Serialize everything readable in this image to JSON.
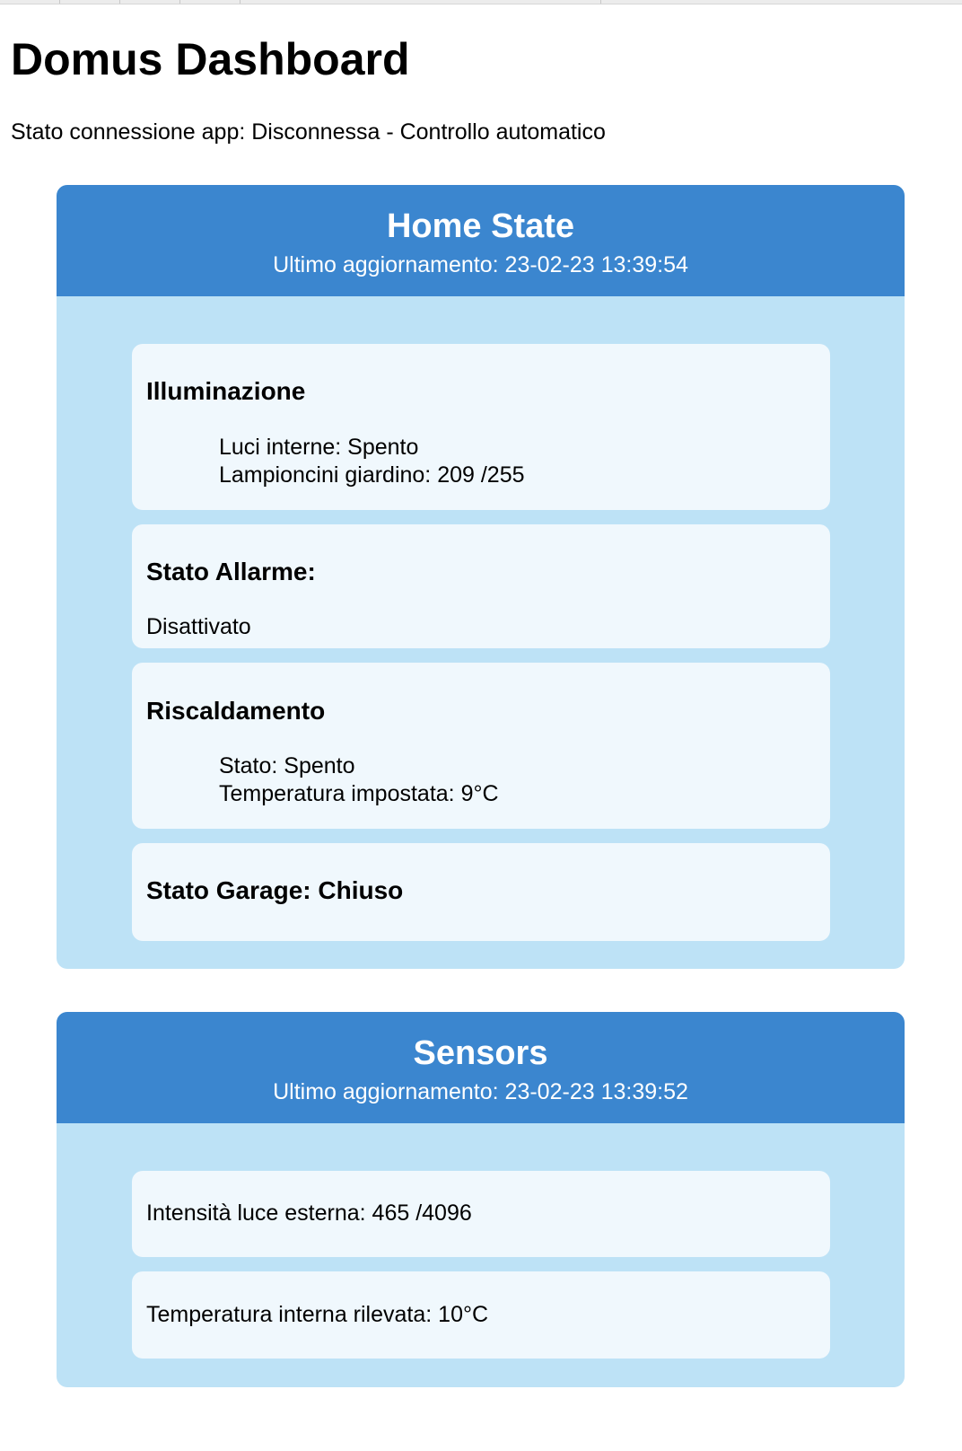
{
  "page": {
    "title": "Domus Dashboard",
    "connection_status": "Stato connessione app: Disconnessa - Controllo automatico"
  },
  "home_state": {
    "title": "Home State",
    "last_update": "Ultimo aggiornamento: 23-02-23 13:39:54",
    "lighting": {
      "title": "Illuminazione",
      "indoor_lights": "Luci interne: Spento",
      "garden_lamps": "Lampioncini giardino: 209 /255"
    },
    "alarm": {
      "title": "Stato Allarme:",
      "value": "Disattivato"
    },
    "heating": {
      "title": "Riscaldamento",
      "state": "Stato: Spento",
      "set_temperature": "Temperatura impostata: 9°C"
    },
    "garage": {
      "title": "Stato Garage: Chiuso"
    }
  },
  "sensors": {
    "title": "Sensors",
    "last_update": "Ultimo aggiornamento: 23-02-23 13:39:52",
    "outdoor_light": "Intensità luce esterna: 465 /4096",
    "indoor_temperature": "Temperatura interna rilevata: 10°C"
  },
  "colors": {
    "header_blue": "#3b86cf",
    "panel_light_blue": "#bde2f6",
    "card_background": "#f0f8fd"
  }
}
